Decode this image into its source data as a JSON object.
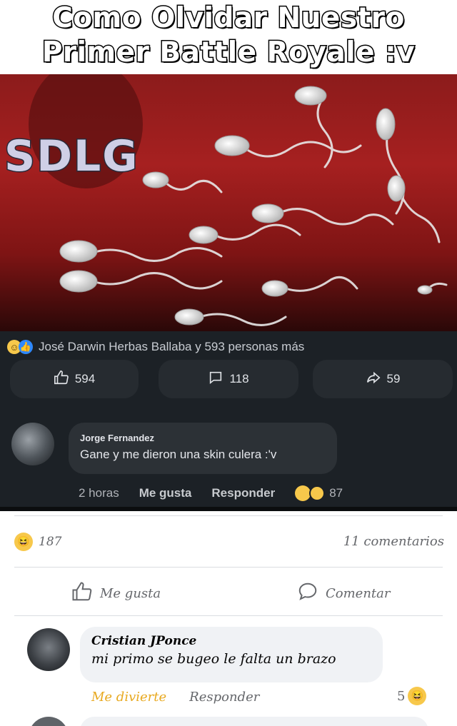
{
  "meme": {
    "title_line1": "Como Olvidar Nuestro",
    "title_line2": "Primer Battle Royale :v",
    "logo_text": "SDLG"
  },
  "dark_post": {
    "reactions_text": "José Darwin Herbas Ballaba y 593 personas más",
    "like_count": "594",
    "comment_count": "118",
    "share_count": "59",
    "comment": {
      "author": "Jorge Fernandez",
      "text": "Gane y me dieron una skin culera :'v",
      "time": "2 horas",
      "like_label": "Me gusta",
      "reply_label": "Responder",
      "reaction_count": "87"
    }
  },
  "outer_post": {
    "reaction_count": "187",
    "comments_text": "11 comentarios",
    "like_label": "Me gusta",
    "comment_label": "Comentar",
    "comment": {
      "author": "Cristian JPonce",
      "text": "mi primo se bugeo le falta un brazo",
      "react_label": "Me divierte",
      "reply_label": "Responder",
      "reaction_count": "5"
    }
  },
  "colors": {
    "image_red": "#a62020",
    "dark_bg": "#1c2126",
    "fb_blue": "#2e89ff",
    "haha_yellow": "#f7c84b",
    "react_orange": "#e8a920"
  }
}
